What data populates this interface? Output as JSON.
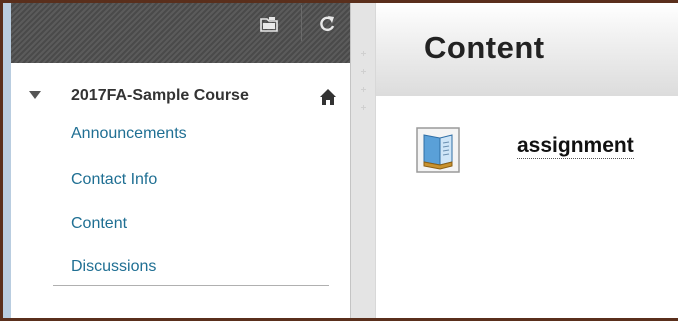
{
  "sidebar": {
    "toolbar": {
      "icons": [
        "folder-icon",
        "refresh-icon"
      ]
    },
    "course_title": "2017FA-Sample Course",
    "menu_items": [
      {
        "label": "Announcements"
      },
      {
        "label": "Contact Info"
      },
      {
        "label": "Content"
      },
      {
        "label": "Discussions"
      }
    ]
  },
  "main": {
    "page_title": "Content",
    "items": [
      {
        "title": "assignment",
        "icon": "assignment-icon"
      }
    ]
  },
  "colors": {
    "link": "#1f6f93",
    "sidebar_border": "#b9cde0",
    "toolbar": "#4a4a4a"
  }
}
